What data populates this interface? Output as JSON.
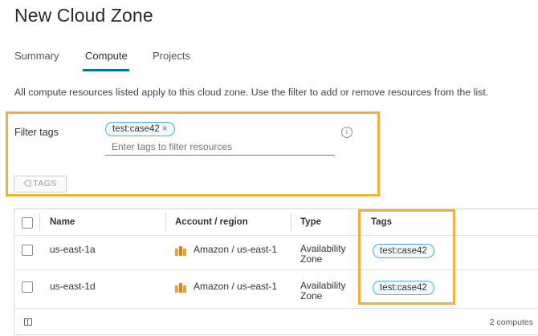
{
  "page": {
    "title": "New Cloud Zone",
    "description": "All compute resources listed apply to this cloud zone. Use the filter to add or remove resources from the list."
  },
  "tabs": [
    {
      "label": "Summary",
      "active": false
    },
    {
      "label": "Compute",
      "active": true
    },
    {
      "label": "Projects",
      "active": false
    }
  ],
  "filter": {
    "label": "Filter tags",
    "chip": "test:case42",
    "chip_close": "×",
    "placeholder": "Enter tags to filter resources",
    "info_icon": "i",
    "tags_button": "TAGS"
  },
  "table": {
    "columns": [
      "Name",
      "Account / region",
      "Type",
      "Tags"
    ],
    "rows": [
      {
        "name": "us-east-1a",
        "account": "Amazon / us-east-1",
        "type_line1": "Availability",
        "type_line2": "Zone",
        "tag": "test:case42"
      },
      {
        "name": "us-east-1d",
        "account": "Amazon / us-east-1",
        "type_line1": "Availability",
        "type_line2": "Zone",
        "tag": "test:case42"
      }
    ],
    "footer_count": "2 computes"
  },
  "colors": {
    "accent": "#0072a3",
    "highlight": "#f2b037",
    "chip_border": "#49afd9",
    "aws_orange": "#f0a030"
  },
  "icons": {
    "info": "info-icon",
    "tag": "tag-icon",
    "provider": "aws-icon",
    "columns": "column-toggle-icon"
  }
}
